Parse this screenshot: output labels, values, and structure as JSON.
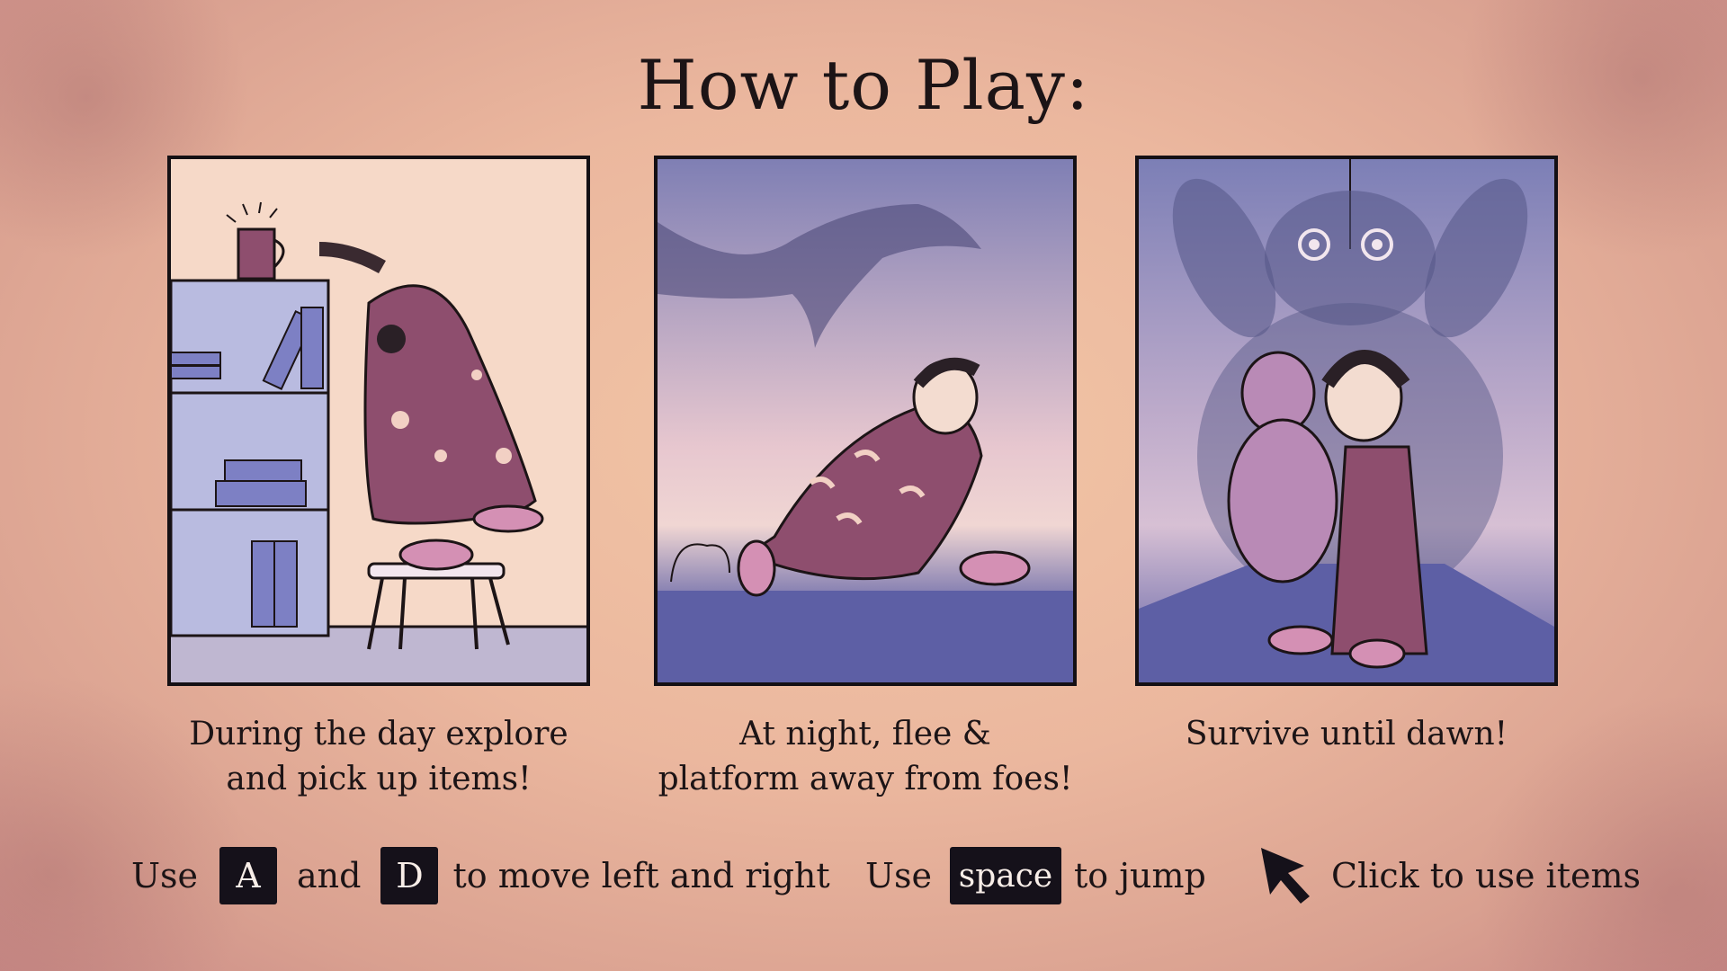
{
  "title": "How to Play:",
  "panels": [
    {
      "caption_line1": "During the day explore",
      "caption_line2": "and pick up items!"
    },
    {
      "caption_line1": "At night, flee &",
      "caption_line2": "platform away from foes!"
    },
    {
      "caption_line1": "Survive until dawn!",
      "caption_line2": ""
    }
  ],
  "controls": {
    "move": {
      "use": "Use",
      "key_left": "A",
      "and": "and",
      "key_right": "D",
      "text": "to move left and right"
    },
    "jump": {
      "use": "Use",
      "key": "space",
      "text": "to jump"
    },
    "click": {
      "icon": "cursor-arrow-icon",
      "text": "Click to use items"
    }
  },
  "colors": {
    "background": "#ebb79e",
    "text": "#1c1416",
    "key_bg": "#15111a",
    "night_blue": "#5d5fa5",
    "blanket": "#8e4e6e"
  }
}
